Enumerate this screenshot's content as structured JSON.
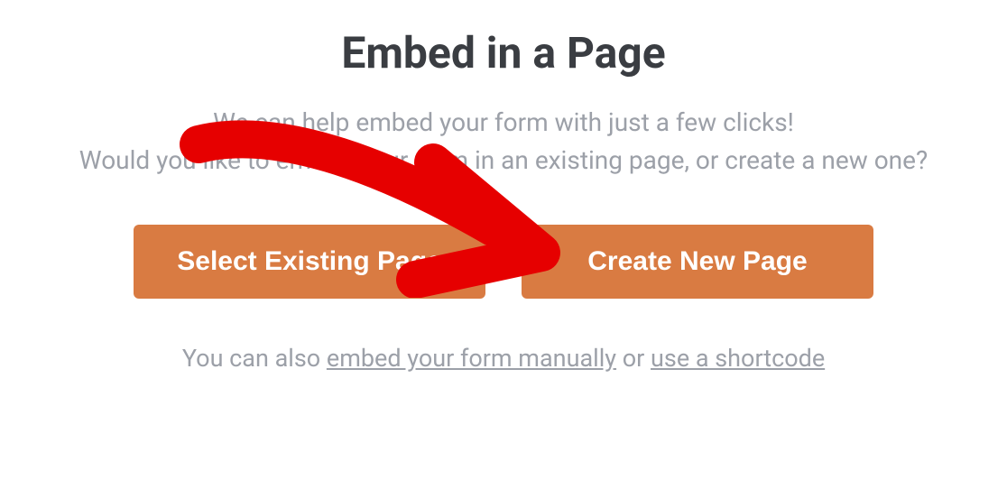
{
  "title": "Embed in a Page",
  "description_line1": "We can help embed your form with just a few clicks!",
  "description_line2": "Would you like to embed your form in an existing page, or create a new one?",
  "buttons": {
    "select_existing": "Select Existing Page",
    "create_new": "Create New Page"
  },
  "footer": {
    "prefix": "You can also ",
    "link1": "embed your form manually",
    "middle": " or ",
    "link2": "use a shortcode"
  }
}
